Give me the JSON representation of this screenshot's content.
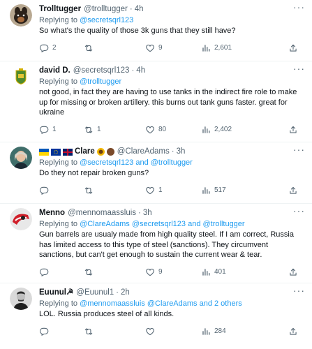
{
  "icons": {
    "reply": "reply-icon",
    "retweet": "retweet-icon",
    "like": "heart-icon",
    "views": "views-icon",
    "share": "share-icon",
    "more": "more-icon"
  },
  "colors": {
    "link": "#1d9bf0",
    "secondary": "#536471",
    "text": "#0f1419"
  },
  "tweets": [
    {
      "name": "Trolltugger",
      "handle": "@trolltugger",
      "dot": "·",
      "time": "4h",
      "reply_prefix": "Replying to ",
      "reply_to": "@secretsqrl123",
      "text": "So what's the quality of those 3k guns that they still have?",
      "replies": "2",
      "retweets": "",
      "likes": "9",
      "views": "2,601"
    },
    {
      "name": "david D.",
      "handle": "@secretsqrl123",
      "dot": "·",
      "time": "4h",
      "reply_prefix": "Replying to ",
      "reply_to": "@trolltugger",
      "text": "not good, in fact they are having to use tanks in the indirect fire role to make up for missing or broken artillery.  this burns out tank guns faster. great for ukraine",
      "replies": "1",
      "retweets": "1",
      "likes": "80",
      "views": "2,402"
    },
    {
      "name": "Clare",
      "handle": "@ClareAdams",
      "dot": "·",
      "time": "3h",
      "reply_prefix": "Replying to ",
      "reply_to": "@secretsqrl123 and @trolltugger",
      "text": "Do they not repair broken guns?",
      "replies": "",
      "retweets": "",
      "likes": "1",
      "views": "517"
    },
    {
      "name": "Menno",
      "handle": "@mennomaassluis",
      "dot": "·",
      "time": "3h",
      "reply_prefix": "Replying to ",
      "reply_to": "@ClareAdams @secretsqrl123 and @trolltugger",
      "text": "Gun barrels are usualy made from high quality steel. If I am correct, Russia has limited access to this type of steel (sanctions). They circumvent sanctions, but can't get enough to sustain the current wear & tear.",
      "replies": "",
      "retweets": "",
      "likes": "9",
      "views": "401"
    },
    {
      "name": "Euunul☭",
      "handle": "@Euunul1",
      "dot": "·",
      "time": "2h",
      "reply_prefix": "Replying to ",
      "reply_to": "@mennomaassluis @ClareAdams and 2 others",
      "text": "LOL. Russia produces steel of all kinds.",
      "replies": "",
      "retweets": "",
      "likes": "",
      "views": "284"
    }
  ]
}
